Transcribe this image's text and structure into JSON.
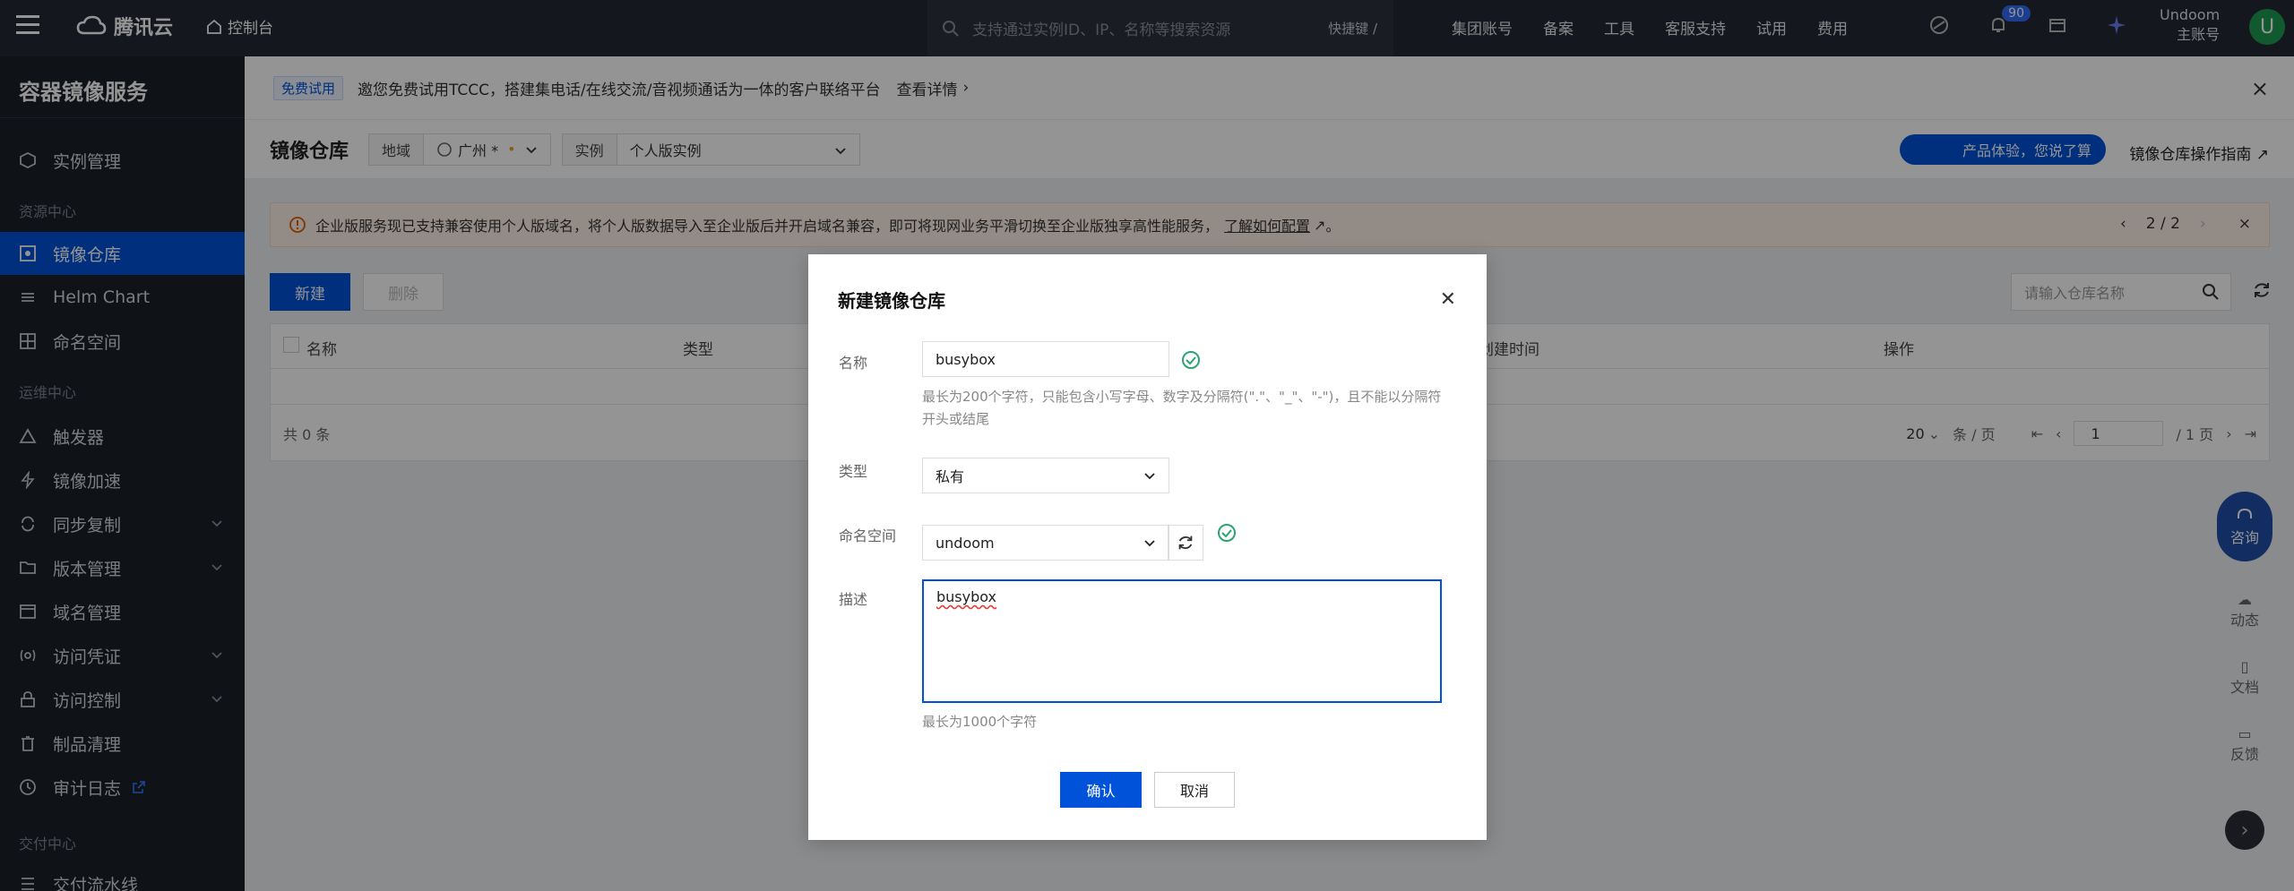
{
  "topbar": {
    "logo": "腾讯云",
    "console": "控制台",
    "search_placeholder": "支持通过实例ID、IP、名称等搜索资源",
    "shortcut": "快捷键 /",
    "nav": [
      "集团账号",
      "备案",
      "工具",
      "客服支持",
      "试用",
      "费用"
    ],
    "notification_count": "90",
    "user_name": "Undoom",
    "user_role": "主账号",
    "avatar_letter": "U"
  },
  "sidebar": {
    "title": "容器镜像服务",
    "groups": [
      "资源中心",
      "运维中心",
      "交付中心"
    ],
    "items": [
      {
        "label": "实例管理",
        "icon": "server-icon"
      },
      {
        "label": "镜像仓库",
        "icon": "repo-icon"
      },
      {
        "label": "Helm Chart",
        "icon": "helm-icon"
      },
      {
        "label": "命名空间",
        "icon": "namespace-icon"
      },
      {
        "label": "触发器",
        "icon": "trigger-icon"
      },
      {
        "label": "镜像加速",
        "icon": "accelerate-icon"
      },
      {
        "label": "同步复制",
        "icon": "sync-icon"
      },
      {
        "label": "版本管理",
        "icon": "folder-icon"
      },
      {
        "label": "域名管理",
        "icon": "domain-icon"
      },
      {
        "label": "访问凭证",
        "icon": "credential-icon"
      },
      {
        "label": "访问控制",
        "icon": "lock-icon"
      },
      {
        "label": "制品清理",
        "icon": "trash-icon"
      },
      {
        "label": "审计日志",
        "icon": "log-icon"
      },
      {
        "label": "交付流水线",
        "icon": "pipeline-icon"
      }
    ]
  },
  "notice": {
    "tag": "免费试用",
    "text": "邀您免费试用TCCC，搭建集电话/在线交流/音视频通话为一体的客户联络平台",
    "more": "查看详情"
  },
  "header": {
    "title": "镜像仓库",
    "region_label": "地域",
    "region_value": "广州 *",
    "instance_label": "实例",
    "instance_value": "个人版实例",
    "feedback_btn": "产品体验，您说了算",
    "guide_link": "镜像仓库操作指南"
  },
  "warning": {
    "text": "企业版服务现已支持兼容使用个人版域名，将个人版数据导入至企业版后并开启域名兼容，即可将现网业务平滑切换至企业版独享高性能服务，",
    "link": "了解如何配置",
    "tail": "。",
    "page": "2 / 2"
  },
  "toolbar": {
    "new": "新建",
    "delete": "删除",
    "search_placeholder": "请输入仓库名称"
  },
  "table": {
    "columns": [
      "名称",
      "类型",
      "创建时间",
      "操作"
    ],
    "total": "共 0 条",
    "page_size": "20",
    "page_size_unit": "条 / 页",
    "page": "1",
    "page_total": "/ 1 页"
  },
  "float": {
    "consult": "咨询",
    "items": [
      "动态",
      "文档",
      "反馈"
    ]
  },
  "modal": {
    "title": "新建镜像仓库",
    "name_label": "名称",
    "name_value": "busybox",
    "name_hint": "最长为200个字符，只能包含小写字母、数字及分隔符(\".\"、\"_\"、\"-\")，且不能以分隔符开头或结尾",
    "type_label": "类型",
    "type_value": "私有",
    "ns_label": "命名空间",
    "ns_value": "undoom",
    "desc_label": "描述",
    "desc_value": "busybox",
    "desc_hint": "最长为1000个字符",
    "confirm": "确认",
    "cancel": "取消"
  }
}
